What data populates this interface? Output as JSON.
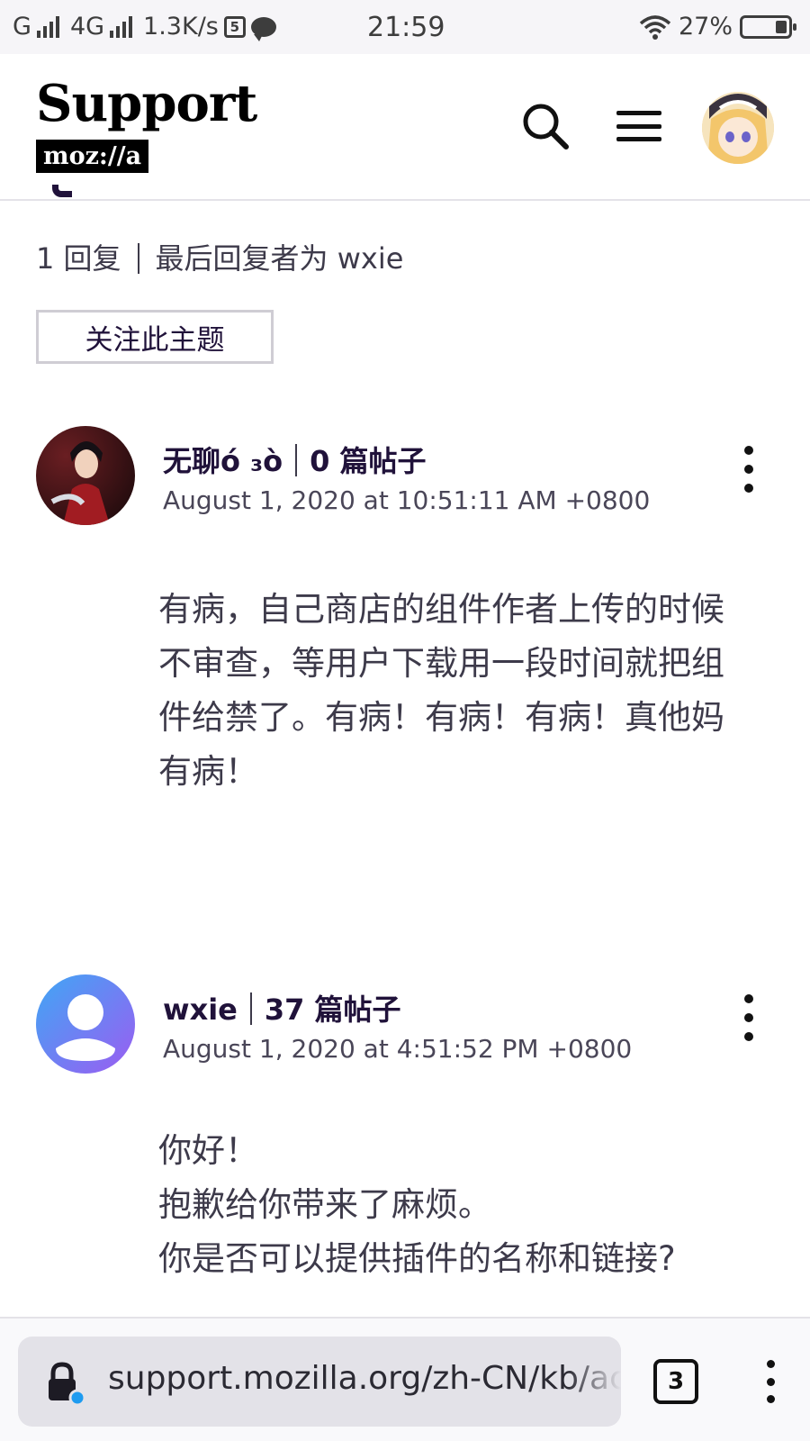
{
  "status_bar": {
    "carrier_g": "G",
    "carrier_4g": "4G",
    "speed": "1.3K/s",
    "sim_icon": "sim-card-icon",
    "time": "21:59",
    "battery": "27%",
    "battery_level": 0.27
  },
  "header": {
    "logo_text": "Support",
    "logo_sub": "moz://a",
    "search_icon": "search-icon",
    "menu_icon": "hamburger-menu-icon",
    "avatar_icon": "user-avatar"
  },
  "thread": {
    "reply_count": "1 回复",
    "last_reply": "最后回复者为 wxie",
    "follow_label": "关注此主题"
  },
  "posts": [
    {
      "author": "无聊ó ₃ò",
      "post_count": "0 篇帖子",
      "date": "August 1, 2020 at 10:51:11 AM +0800",
      "body_lines": [
        "有病，自己商店的组件作者上传的时候",
        "不审查，等用户下载用一段时间就把组",
        "件给禁了。有病！有病！有病！真他妈",
        "有病！"
      ]
    },
    {
      "author": "wxie",
      "post_count": "37 篇帖子",
      "date": "August 1, 2020 at 4:51:52 PM +0800",
      "body_lines": [
        "你好！",
        "抱歉给你带来了麻烦。",
        "你是否可以提供插件的名称和链接?"
      ]
    }
  ],
  "browser": {
    "url": "support.mozilla.org/zh-CN/kb/ac",
    "tab_count": "3"
  },
  "colors": {
    "text_dark": "#20123a",
    "url_bar": "#e3e2e8",
    "lock_badge": "#1e9bf0"
  }
}
